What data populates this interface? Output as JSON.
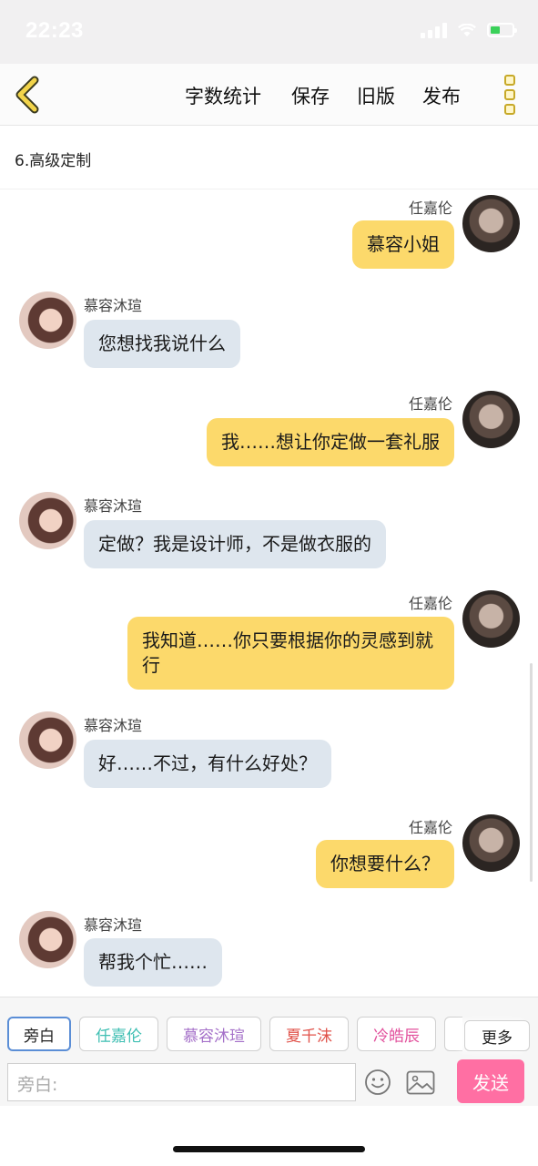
{
  "status_bar": {
    "time": "22:23"
  },
  "toolbar": {
    "word_count": "字数统计",
    "save": "保存",
    "old_version": "旧版",
    "publish": "发布"
  },
  "chapter": {
    "title": "6.高级定制"
  },
  "messages": [
    {
      "speaker": "任嘉伦",
      "text": "慕容小姐",
      "side": "right"
    },
    {
      "speaker": "慕容沐瑄",
      "text": "您想找我说什么",
      "side": "left"
    },
    {
      "speaker": "任嘉伦",
      "text": "我……想让你定做一套礼服",
      "side": "right"
    },
    {
      "speaker": "慕容沐瑄",
      "text": "定做？我是设计师，不是做衣服的",
      "side": "left"
    },
    {
      "speaker": "任嘉伦",
      "text": "我知道……你只要根据你的灵感到就行",
      "side": "right"
    },
    {
      "speaker": "慕容沐瑄",
      "text": "好……不过，有什么好处？",
      "side": "left"
    },
    {
      "speaker": "任嘉伦",
      "text": "你想要什么？",
      "side": "right"
    },
    {
      "speaker": "慕容沐瑄",
      "text": "帮我个忙……",
      "side": "left"
    }
  ],
  "characters": [
    {
      "name": "旁白",
      "color": "#222222"
    },
    {
      "name": "任嘉伦",
      "color": "#3fbfb3"
    },
    {
      "name": "慕容沐瑄",
      "color": "#a571c9"
    },
    {
      "name": "夏千沫",
      "color": "#e0524a"
    },
    {
      "name": "冷皓辰",
      "color": "#e2509c"
    }
  ],
  "more_characters": "更多",
  "input": {
    "placeholder": "旁白:"
  },
  "send": "发送",
  "colors": {
    "accent": "#ff6fa3",
    "bubble_right": "#fcd96b",
    "bubble_left": "#dee6ee",
    "icon_yellow": "#e8c72e"
  }
}
